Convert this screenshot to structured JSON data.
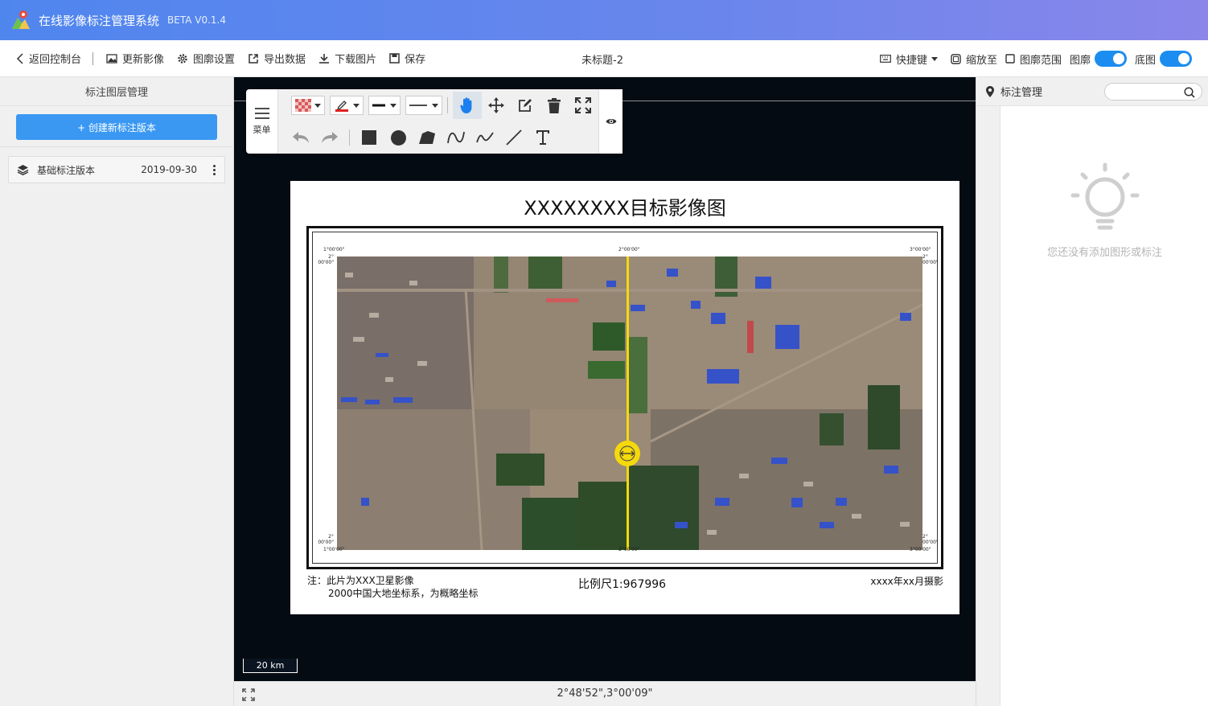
{
  "app": {
    "title": "在线影像标注管理系统",
    "version": "BETA V0.1.4"
  },
  "toolbar": {
    "back": "返回控制台",
    "update_image": "更新影像",
    "frame_settings": "图廓设置",
    "export_data": "导出数据",
    "download_image": "下载图片",
    "save": "保存",
    "doc_title": "未标题-2",
    "shortcuts": "快捷键",
    "zoom_to": "缩放至",
    "frame_range": "图廓范围",
    "frame_toggle_label": "图廓",
    "frame_toggle_on": true,
    "basemap_toggle_label": "底图",
    "basemap_toggle_on": true
  },
  "left_panel": {
    "header": "标注图层管理",
    "create_button": "+ 创建新标注版本",
    "versions": [
      {
        "name": "基础标注版本",
        "date": "2019-09-30"
      }
    ]
  },
  "draw_toolbar": {
    "menu_label": "菜单",
    "active_tool": "hand-icon",
    "row1_tools": [
      "fill-pattern-dropdown",
      "stroke-color-dropdown",
      "line-weight-dropdown",
      "line-style-dropdown",
      "hand-icon",
      "move-icon",
      "edit-icon",
      "delete-icon",
      "fullscreen-icon"
    ],
    "row2_tools": [
      "undo-icon",
      "redo-icon",
      "rectangle-icon",
      "circle-icon",
      "polygon-icon",
      "curve-icon",
      "polyline-icon",
      "line-icon",
      "text-icon"
    ]
  },
  "sheet": {
    "title": "XXXXXXXX目标影像图",
    "coords": {
      "top_left": "1°00'00\"",
      "top_mid": "2°00'00\"",
      "top_right": "3°00'00\"",
      "left_top": "2°\n00'00\"",
      "right_top": "2°\n00'00\"",
      "left_bottom": "2°\n00'00\"",
      "right_bottom": "2°\n00'00\"",
      "bottom_left": "1°00'00\"",
      "bottom_mid": "2°00'00\"",
      "bottom_right": "3°00'00\""
    },
    "note_line1": "注：此片为XXX卫星影像",
    "note_line2": "2000中国大地坐标系，为概略坐标",
    "scale": "比例尺1:967996",
    "date": "xxxx年xx月摄影"
  },
  "map": {
    "scalebar": "20 km",
    "cursor_coords": "2°48'52\",3°00'09\""
  },
  "right_panel": {
    "header": "标注管理",
    "search_placeholder": "",
    "empty_text": "您还没有添加图形或标注"
  },
  "colors": {
    "accent": "#3a98f3",
    "header_start": "#4f86ee",
    "header_end": "#8a86ea",
    "swipe_line": "#f5d90a"
  }
}
